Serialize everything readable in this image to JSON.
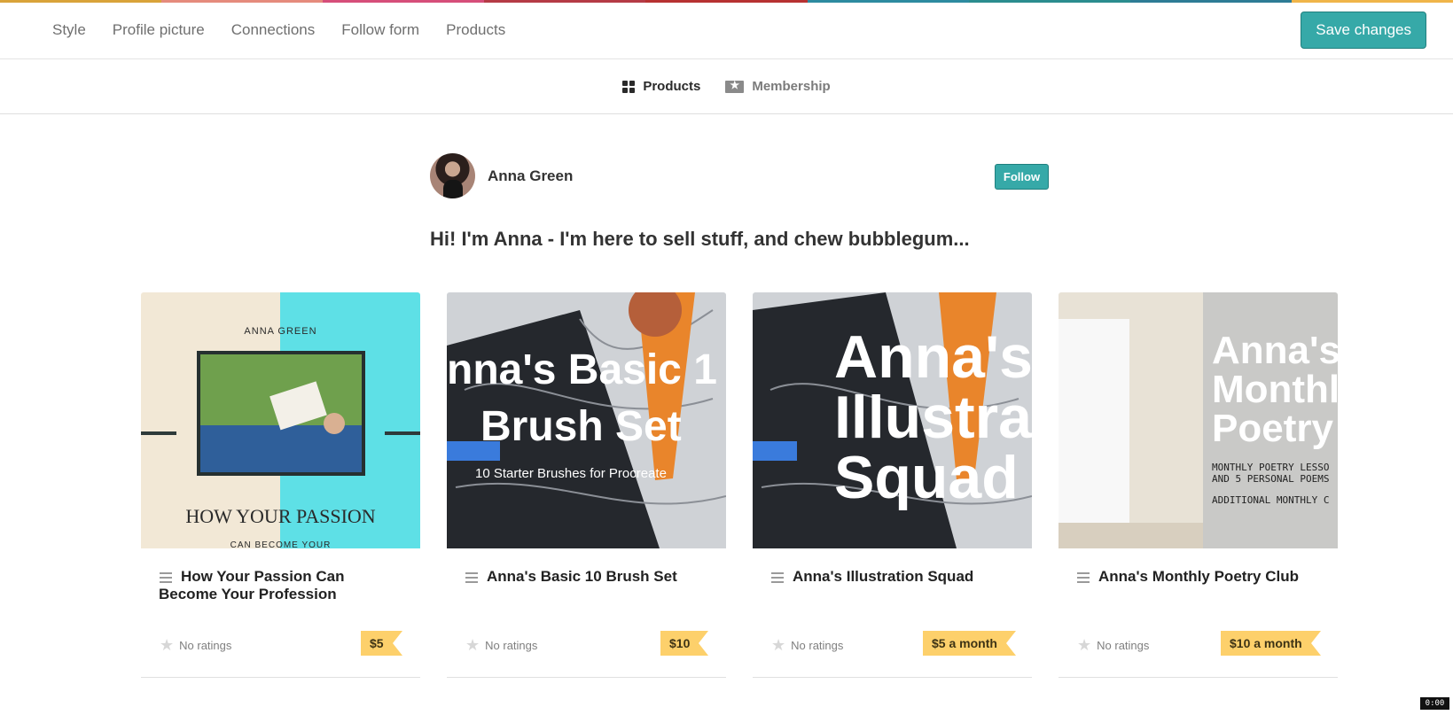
{
  "topbar": {
    "stripe_colors": [
      "#d9a33a",
      "#e58b7d",
      "#d64e7a",
      "#b53b46",
      "#b73232",
      "#2d8ba0",
      "#2b8d8f",
      "#2e7c95",
      "#f0b54a"
    ],
    "nav": [
      "Style",
      "Profile picture",
      "Connections",
      "Follow form",
      "Products"
    ],
    "save_label": "Save changes"
  },
  "subnav": {
    "tabs": [
      {
        "label": "Products",
        "icon": "grid-icon",
        "active": true
      },
      {
        "label": "Membership",
        "icon": "ticket-icon",
        "active": false
      }
    ]
  },
  "profile": {
    "name": "Anna Green",
    "follow_label": "Follow",
    "bio": "Hi! I'm Anna - I'm here to sell stuff, and chew bubblegum..."
  },
  "products": [
    {
      "title": "How Your Passion Can Become Your Profession",
      "rating": "No ratings",
      "price": "$5",
      "thumb": {
        "author": "ANNA GREEN",
        "heading": "HOW YOUR PASSION",
        "sub": "CAN BECOME YOUR"
      }
    },
    {
      "title": "Anna's Basic 10 Brush Set",
      "rating": "No ratings",
      "price": "$10",
      "thumb": {
        "line1": "nna's Basic 1",
        "line2": "Brush Set",
        "sub": "10 Starter Brushes for Procreate"
      }
    },
    {
      "title": "Anna's Illustration Squad",
      "rating": "No ratings",
      "price": "$5 a month",
      "thumb": {
        "line1": "Anna's",
        "line2": "Illustrat",
        "line3": "Squad"
      }
    },
    {
      "title": "Anna's Monthly Poetry Club",
      "rating": "No ratings",
      "price": "$10 a month",
      "thumb": {
        "line1": "Anna's",
        "line2": "Monthl",
        "line3": "Poetry",
        "sub1": "MONTHLY POETRY LESSO",
        "sub2": "AND 5 PERSONAL POEMS",
        "sub3": "ADDITIONAL MONTHLY C"
      }
    }
  ],
  "clock": "0:00"
}
